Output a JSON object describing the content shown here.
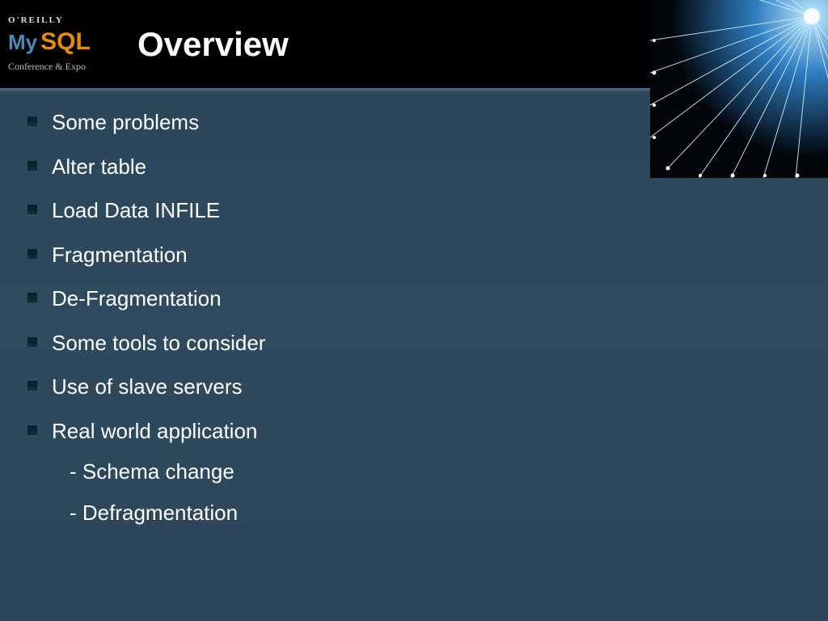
{
  "header": {
    "logo_top": "O'REILLY",
    "logo_left": "My",
    "logo_right": "SQL",
    "logo_sub": "Conference & Expo",
    "title": "Overview"
  },
  "bullets": [
    {
      "text": "Some problems"
    },
    {
      "text": "Alter table"
    },
    {
      "text": "Load Data INFILE"
    },
    {
      "text": "Fragmentation"
    },
    {
      "text": "De-Fragmentation"
    },
    {
      "text": "Some tools to consider"
    },
    {
      "text": "Use of slave servers"
    },
    {
      "text": "Real world application",
      "sub": [
        "- Schema change",
        "- Defragmentation"
      ]
    }
  ]
}
